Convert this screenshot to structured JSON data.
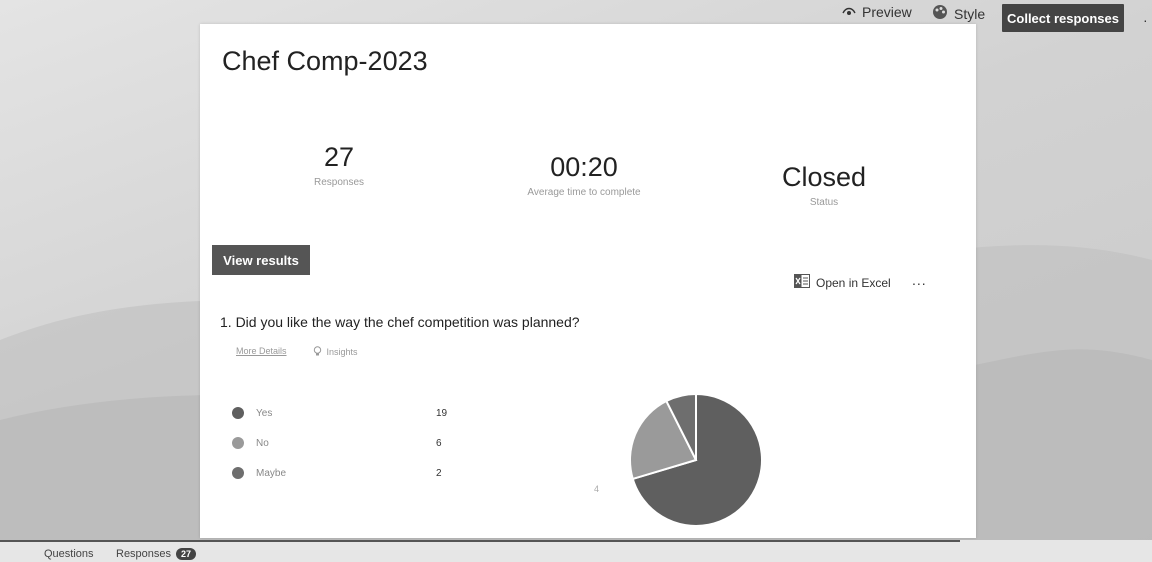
{
  "topbar": {
    "preview_label": "Preview",
    "style_label": "Style",
    "collect_label": "Collect responses"
  },
  "form": {
    "title": "Chef Comp-2023"
  },
  "stats": [
    {
      "value": "27",
      "label": "Responses"
    },
    {
      "value": "00:20",
      "label": "Average time to complete"
    },
    {
      "value": "Closed",
      "label": "Status"
    }
  ],
  "view_results_label": "View results",
  "excel_label": "Open in Excel",
  "more_label": "...",
  "question": {
    "text": "1. Did you like the way the chef competition was planned?",
    "more_details": "More Details",
    "insights": "Insights",
    "options": [
      {
        "label": "Yes",
        "count": "19",
        "color": "#5f5f5f"
      },
      {
        "label": "No",
        "count": "6",
        "color": "#9a9a9a"
      },
      {
        "label": "Maybe",
        "count": "2",
        "color": "#6e6e6e"
      }
    ],
    "chart_note": "4"
  },
  "tabs": {
    "questions": "Questions",
    "responses": "Responses",
    "responses_count": "27"
  }
}
